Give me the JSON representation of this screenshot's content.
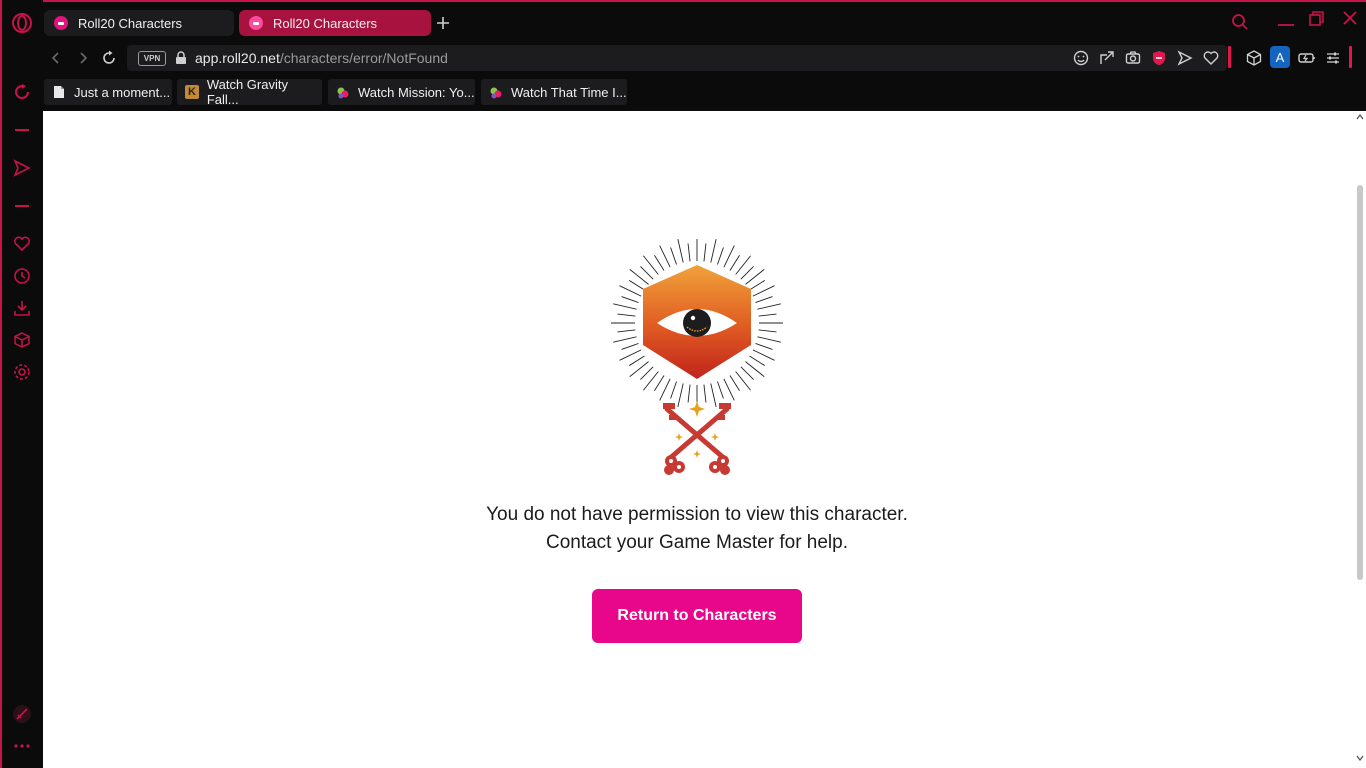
{
  "tabs": [
    {
      "label": "Roll20 Characters",
      "active": false
    },
    {
      "label": "Roll20 Characters",
      "active": true
    }
  ],
  "address": {
    "vpn_label": "VPN",
    "url_domain": "app.roll20.net",
    "url_path": "/characters/error/NotFound"
  },
  "toolbar": {
    "profile_letter": "A"
  },
  "bookmarks": [
    {
      "label": "Just a moment...",
      "icon": "page-icon"
    },
    {
      "label": "Watch Gravity Fall...",
      "icon": "k-logo-icon"
    },
    {
      "label": "Watch Mission: Yo...",
      "icon": "grape-icon"
    },
    {
      "label": "Watch That Time I...",
      "icon": "grape-icon"
    }
  ],
  "content": {
    "message_line1": "You do not have permission to view this character.",
    "message_line2": "Contact your Game Master for help.",
    "return_button": "Return to Characters"
  },
  "colors": {
    "accent": "#c8124a",
    "button": "#e8068a",
    "tab_active": "#a8123f"
  }
}
